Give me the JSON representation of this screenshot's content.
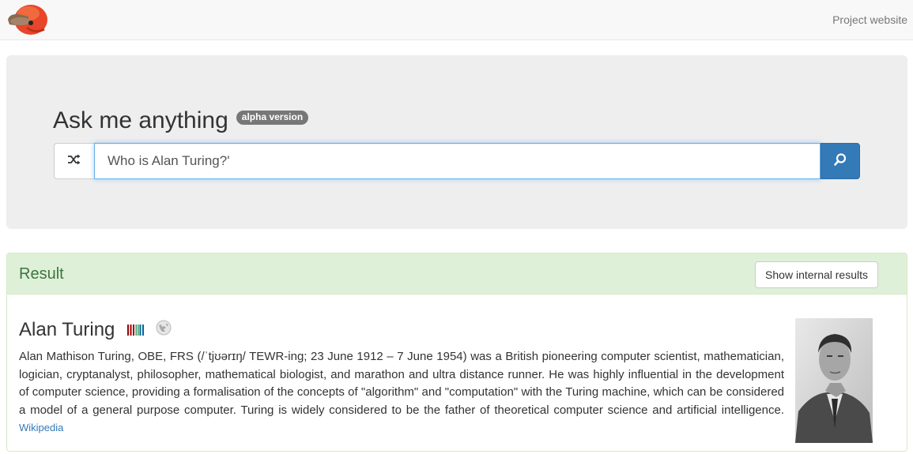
{
  "navbar": {
    "logo_icon": "platypus-logo-icon",
    "link_label": "Project website"
  },
  "hero": {
    "title": "Ask me anything",
    "badge": "alpha version",
    "shuffle_icon": "shuffle-icon",
    "search_value": "Who is Alan Turing?'",
    "search_icon": "search-icon"
  },
  "result": {
    "heading": "Result",
    "internal_button_label": "Show internal results",
    "entity": {
      "name": "Alan Turing",
      "wikidata_icon": "wikidata-icon",
      "wikipedia_icon": "wikipedia-icon",
      "description": "Alan Mathison Turing, OBE, FRS (/ˈtjʊərɪŋ/ TEWR-ing; 23 June 1912 – 7 June 1954) was a British pioneering computer scientist, mathematician, logician, cryptanalyst, philosopher, mathematical biologist, and marathon and ultra distance runner. He was highly influential in the development of computer science, providing a formalisation of the concepts of \"algorithm\" and \"computation\" with the Turing machine, which can be considered a model of a general purpose computer. Turing is widely considered to be the father of theoretical computer science and artificial intelligence.",
      "source_link": "Wikipedia",
      "image_icon": "portrait-photo"
    }
  },
  "colors": {
    "primary": "#337ab7",
    "success_bg": "#dff0d8",
    "success_text": "#3c763d",
    "badge": "#777777"
  }
}
